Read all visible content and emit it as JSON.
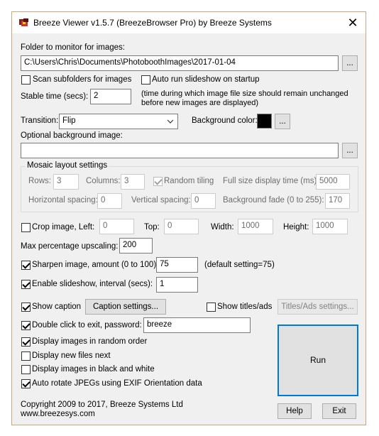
{
  "window": {
    "title": "Breeze Viewer v1.5.7 (BreezeBrowser Pro) by Breeze Systems",
    "close_glyph": "✕"
  },
  "folder": {
    "label": "Folder to monitor for images:",
    "value": "C:\\Users\\Chris\\Documents\\PhotoboothImages\\2017-01-04",
    "browse_label": "..."
  },
  "scan_subfolders": {
    "label": "Scan subfolders for images",
    "checked": false
  },
  "auto_run": {
    "label": "Auto run slideshow on startup",
    "checked": false
  },
  "stable_time": {
    "label": "Stable time (secs):",
    "value": "2",
    "note_line1": "(time during which image file size should remain unchanged",
    "note_line2": "before new images are displayed)"
  },
  "transition": {
    "label": "Transition:",
    "value": "Flip"
  },
  "background_color": {
    "label": "Background color:",
    "color": "#000000",
    "button_label": "..."
  },
  "background_image": {
    "label": "Optional background image:",
    "value": "",
    "browse_label": "..."
  },
  "mosaic": {
    "title": "Mosaic layout settings",
    "rows_label": "Rows:",
    "rows_value": "3",
    "columns_label": "Columns:",
    "columns_value": "3",
    "random_tiling_label": "Random tiling",
    "random_tiling_checked": true,
    "full_size_label": "Full size display time (ms):",
    "full_size_value": "5000",
    "h_spacing_label": "Horizontal spacing:",
    "h_spacing_value": "0",
    "v_spacing_label": "Vertical spacing:",
    "v_spacing_value": "0",
    "bg_fade_label": "Background fade (0 to 255):",
    "bg_fade_value": "170"
  },
  "crop": {
    "label": "Crop image, Left:",
    "checked": false,
    "left_value": "0",
    "top_label": "Top:",
    "top_value": "0",
    "width_label": "Width:",
    "width_value": "1000",
    "height_label": "Height:",
    "height_value": "1000"
  },
  "max_upscaling": {
    "label": "Max percentage upscaling:",
    "value": "200"
  },
  "sharpen": {
    "label": "Sharpen image, amount (0 to 100):",
    "checked": true,
    "value": "75",
    "note": "(default setting=75)"
  },
  "slideshow": {
    "label": "Enable slideshow, interval (secs):",
    "checked": true,
    "value": "1"
  },
  "show_caption": {
    "label": "Show caption",
    "checked": true,
    "button_label": "Caption settings..."
  },
  "show_titles": {
    "label": "Show titles/ads",
    "checked": false,
    "button_label": "Titles/Ads settings..."
  },
  "double_click": {
    "label": "Double click to exit, password:",
    "checked": true,
    "value": "breeze"
  },
  "random_order": {
    "label": "Display images in random order",
    "checked": true
  },
  "new_files_next": {
    "label": "Display new files next",
    "checked": false
  },
  "black_white": {
    "label": "Display images in black and white",
    "checked": false
  },
  "auto_rotate": {
    "label": "Auto rotate JPEGs using EXIF Orientation data",
    "checked": true
  },
  "run_label": "Run",
  "copyright": {
    "line1": "Copyright 2009 to 2017, Breeze Systems Ltd",
    "line2": "www.breezesys.com"
  },
  "help_label": "Help",
  "exit_label": "Exit"
}
